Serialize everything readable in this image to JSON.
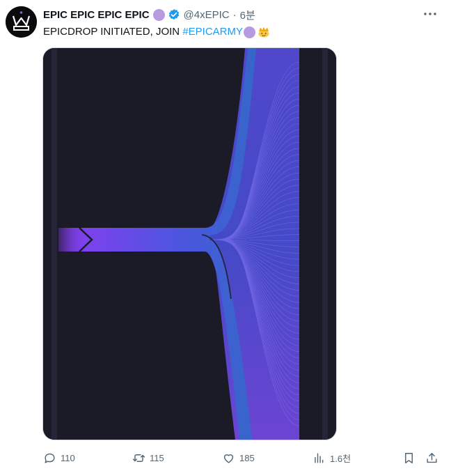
{
  "tweet": {
    "display_name": "EPIC EPIC EPIC EPIC",
    "handle": "@4xEPIC",
    "separator": "·",
    "time": "6분",
    "text_prefix": "EPICDROP INITIATED, JOIN ",
    "hashtag": "#EPICARMY",
    "badge_color": "#b79be0",
    "verified_color": "#1d9bf0"
  },
  "icons": {
    "avatar": "crown-logo",
    "verified": "verified-badge-icon",
    "more": "more-icon",
    "emoji": "crown-face-emoji"
  },
  "media": {
    "background": "#1b1b28",
    "gradient_start": "#7c3ff0",
    "gradient_mid": "#3f6fd8",
    "gradient_end": "#6a4ff2"
  },
  "actions": {
    "replies": "110",
    "retweets": "115",
    "likes": "185",
    "views": "1.6천"
  }
}
